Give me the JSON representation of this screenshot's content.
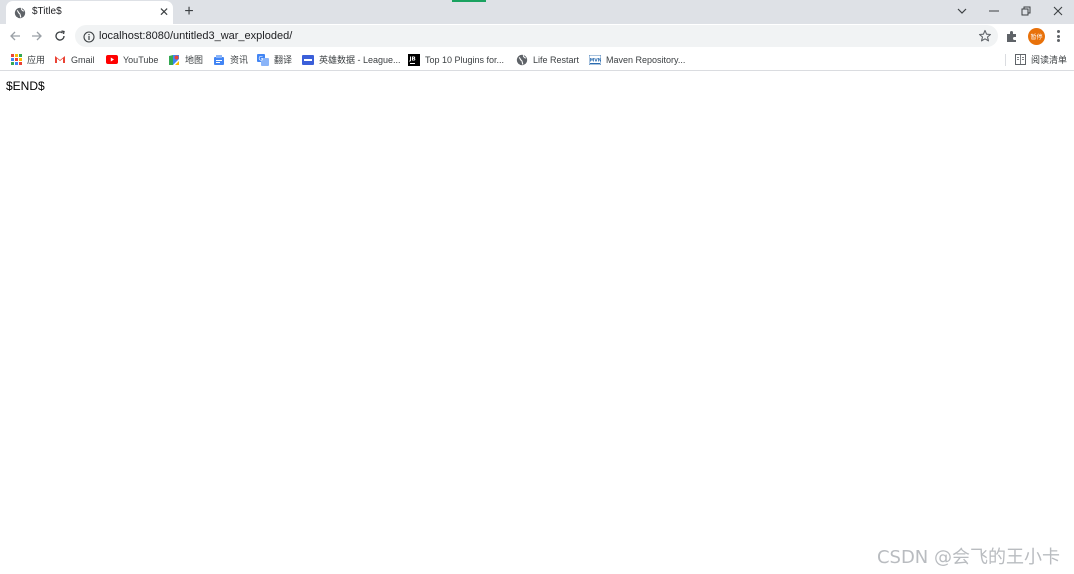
{
  "tab": {
    "title": "$Title$",
    "close_glyph": "✕",
    "new_tab_glyph": "+"
  },
  "omnibox": {
    "url_host": "localhost",
    "url_path": ":8080/untitled3_war_exploded/"
  },
  "profile": {
    "avatar_text": "暂停"
  },
  "bookmarks": [
    {
      "label": "应用",
      "icon": "apps-grid-icon"
    },
    {
      "label": "Gmail",
      "icon": "gmail-icon"
    },
    {
      "label": "YouTube",
      "icon": "youtube-icon"
    },
    {
      "label": "地图",
      "icon": "maps-icon"
    },
    {
      "label": "资讯",
      "icon": "news-icon"
    },
    {
      "label": "翻译",
      "icon": "translate-icon"
    },
    {
      "label": "英雄数据 - League...",
      "icon": "league-icon"
    },
    {
      "label": "Top 10 Plugins for...",
      "icon": "jetbrains-icon"
    },
    {
      "label": "Life Restart",
      "icon": "globe-icon"
    },
    {
      "label": "Maven Repository...",
      "icon": "maven-icon"
    }
  ],
  "reading_list": {
    "label": "阅读清单",
    "icon": "reading-list-icon"
  },
  "page": {
    "body_text": "$END$"
  },
  "watermark": "CSDN @会飞的王小卡",
  "colors": {
    "tabstrip": "#dee1e6",
    "omnibox": "#f1f3f4",
    "avatar": "#e8710a",
    "youtube_red": "#ff0000",
    "gmail_red": "#ea4335",
    "accent_green": "#1aa260"
  }
}
